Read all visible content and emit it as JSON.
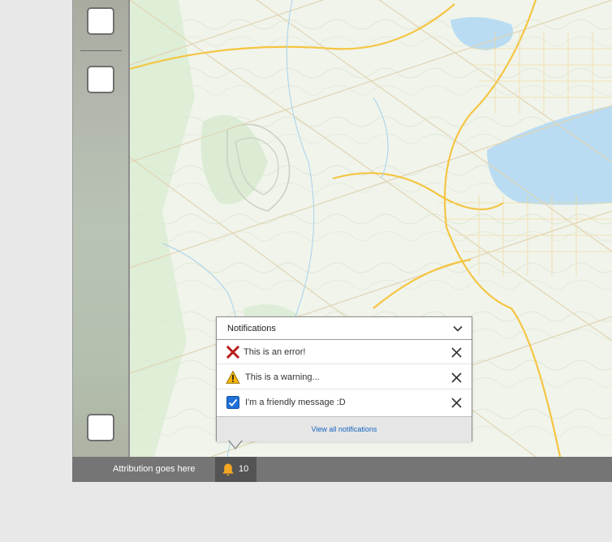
{
  "statusbar": {
    "attribution": "Attribution goes here",
    "notification_count": "10"
  },
  "notifications": {
    "title": "Notifications",
    "items": [
      {
        "type": "error",
        "icon": "error-x-icon",
        "text": "This is an error!"
      },
      {
        "type": "warning",
        "icon": "warning-triangle-icon",
        "text": "This is a warning..."
      },
      {
        "type": "info",
        "icon": "checkbox-checked-icon",
        "text": "I'm a friendly message :D"
      }
    ],
    "view_all_label": "View all notifications"
  },
  "colors": {
    "error": "#b71c1c",
    "warning": "#f4b400",
    "info": "#1e6fd9",
    "link": "#1565c0",
    "bell": "#f5a623",
    "water": "#b9dcf2",
    "roads": "#f5c542"
  }
}
